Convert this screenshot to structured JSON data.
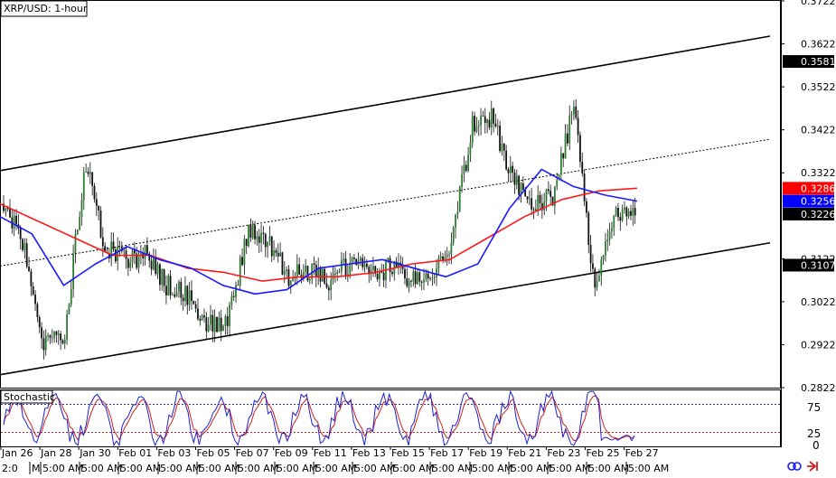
{
  "title": "XRP/USD: 1-hour",
  "colors": {
    "bull": "#2e7d32",
    "bear": "#111111",
    "ma_fast": "#1a1aff",
    "ma_slow": "#ff1a1a",
    "channel": "#000000",
    "stoch_k": "#2020cc",
    "stoch_d": "#cc2020",
    "stoch_level_high": "#3333aa",
    "stoch_level_low": "#cc2222"
  },
  "price_axis": {
    "ticks": [
      "0.3722",
      "0.3622",
      "0.3522",
      "0.3422",
      "0.3322",
      "0.3122",
      "0.3022",
      "0.2922",
      "0.2822"
    ],
    "price_labels": [
      {
        "text": "0.3581",
        "value": 0.3581,
        "bg": "#000000",
        "fg": "#ffffff"
      },
      {
        "text": "0.3286",
        "value": 0.3286,
        "bg": "#ff0000",
        "fg": "#ffffff"
      },
      {
        "text": "0.3256",
        "value": 0.3256,
        "bg": "#0000ff",
        "fg": "#ffffff"
      },
      {
        "text": "0.3226",
        "value": 0.3226,
        "bg": "#000000",
        "fg": "#ffffff"
      },
      {
        "text": "0.3107",
        "value": 0.3107,
        "bg": "#000000",
        "fg": "#ffffff"
      }
    ]
  },
  "stochastic": {
    "label": "Stochastic",
    "levels": [
      "75",
      "25"
    ],
    "zero": "0"
  },
  "date_labels": [
    "Jan 26",
    "Jan 28",
    "Jan 30",
    "Feb 01",
    "Feb 03",
    "Feb 05",
    "Feb 07",
    "Feb 09",
    "Feb 11",
    "Feb 13",
    "Feb 15",
    "Feb 17",
    "Feb 19",
    "Feb 21",
    "Feb 23",
    "Feb 25",
    "Feb 27"
  ],
  "time_labels": [
    "2:0",
    "M",
    "5:00 AM",
    "5:00 AM",
    "5:00 AM",
    "5:00 AM",
    "5:00 AM",
    "5:00 AM",
    "5:00 AM",
    "5:00 AM",
    "5:00 AM",
    "5:00 AM",
    "5:00 AM",
    "5:00 AM",
    "5:00 AM",
    "5:00 AM",
    "5:00 AM",
    "5:00 AM"
  ],
  "chart_data": {
    "type": "candlestick",
    "title": "XRP/USD: 1-hour",
    "ylim": [
      0.2822,
      0.3722
    ],
    "x_labels": [
      "Jan 26",
      "Jan 28",
      "Jan 30",
      "Feb 01",
      "Feb 03",
      "Feb 05",
      "Feb 07",
      "Feb 09",
      "Feb 11",
      "Feb 13",
      "Feb 15",
      "Feb 17",
      "Feb 19",
      "Feb 21",
      "Feb 23",
      "Feb 25",
      "Feb 27"
    ],
    "price_path": [
      {
        "date": "Jan 26",
        "close": 0.325
      },
      {
        "date": "Jan 27",
        "close": 0.316
      },
      {
        "date": "Jan 28",
        "close": 0.292
      },
      {
        "date": "Jan 29",
        "close": 0.294
      },
      {
        "date": "Jan 30",
        "close": 0.335
      },
      {
        "date": "Jan 31",
        "close": 0.315
      },
      {
        "date": "Feb 01",
        "close": 0.312
      },
      {
        "date": "Feb 02",
        "close": 0.313
      },
      {
        "date": "Feb 03",
        "close": 0.306
      },
      {
        "date": "Feb 04",
        "close": 0.304
      },
      {
        "date": "Feb 05",
        "close": 0.297
      },
      {
        "date": "Feb 06",
        "close": 0.298
      },
      {
        "date": "Feb 07",
        "close": 0.318
      },
      {
        "date": "Feb 08",
        "close": 0.316
      },
      {
        "date": "Feb 09",
        "close": 0.308
      },
      {
        "date": "Feb 10",
        "close": 0.309
      },
      {
        "date": "Feb 11",
        "close": 0.307
      },
      {
        "date": "Feb 12",
        "close": 0.311
      },
      {
        "date": "Feb 13",
        "close": 0.309
      },
      {
        "date": "Feb 14",
        "close": 0.31
      },
      {
        "date": "Feb 15",
        "close": 0.307
      },
      {
        "date": "Feb 16",
        "close": 0.309
      },
      {
        "date": "Feb 17",
        "close": 0.316
      },
      {
        "date": "Feb 18",
        "close": 0.343
      },
      {
        "date": "Feb 19",
        "close": 0.345
      },
      {
        "date": "Feb 20",
        "close": 0.33
      },
      {
        "date": "Feb 21",
        "close": 0.325
      },
      {
        "date": "Feb 22",
        "close": 0.327
      },
      {
        "date": "Feb 23",
        "close": 0.348
      },
      {
        "date": "Feb 24",
        "close": 0.306
      },
      {
        "date": "Feb 25",
        "close": 0.322
      },
      {
        "date": "Feb 26",
        "close": 0.3226
      }
    ],
    "series": [
      {
        "name": "0.3256",
        "color": "#1a1aff",
        "values": [
          0.322,
          0.318,
          0.306,
          0.311,
          0.315,
          0.312,
          0.31,
          0.306,
          0.304,
          0.305,
          0.31,
          0.311,
          0.312,
          0.31,
          0.308,
          0.311,
          0.324,
          0.333,
          0.329,
          0.327,
          0.3256
        ]
      },
      {
        "name": "0.3286",
        "color": "#ff1a1a",
        "values": [
          0.325,
          0.321,
          0.317,
          0.313,
          0.313,
          0.31,
          0.309,
          0.307,
          0.308,
          0.308,
          0.309,
          0.311,
          0.312,
          0.317,
          0.322,
          0.326,
          0.328,
          0.3286
        ]
      }
    ],
    "channel": {
      "upper": {
        "start": 0.3327,
        "end": 0.364
      },
      "middle": {
        "start": 0.3105,
        "end": 0.34
      },
      "lower": {
        "start": 0.2852,
        "end": 0.3159
      }
    },
    "stochastic_levels": [
      75,
      25
    ],
    "stochastic_range": [
      0,
      100
    ]
  }
}
